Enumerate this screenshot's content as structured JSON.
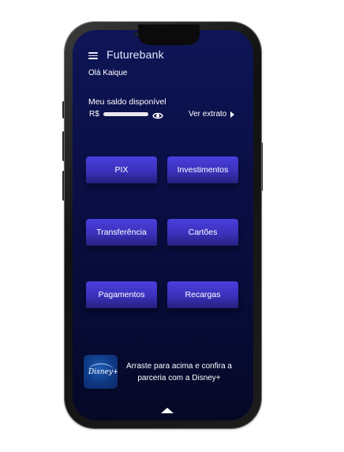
{
  "header": {
    "brand": "Futurebank",
    "greeting": "Olá Kaique"
  },
  "balance": {
    "title": "Meu saldo disponível",
    "currency": "R$",
    "statement_link": "Ver extrato"
  },
  "actions": [
    {
      "label": "PIX"
    },
    {
      "label": "Investimentos"
    },
    {
      "label": "Transferência"
    },
    {
      "label": "Cartões"
    },
    {
      "label": "Pagamentos"
    },
    {
      "label": "Recargas"
    }
  ],
  "promo": {
    "logo_text": "Disney+",
    "text": "Arraste para acima e confira a parceria com a Disney+"
  },
  "icons": {
    "menu": "hamburger-menu-icon",
    "eye": "eye-icon",
    "statement": "caret-right-icon",
    "swipe": "caret-up-icon"
  },
  "colors": {
    "background": "#0a0f45",
    "button": "#3a31bb",
    "text": "#ffffff"
  }
}
